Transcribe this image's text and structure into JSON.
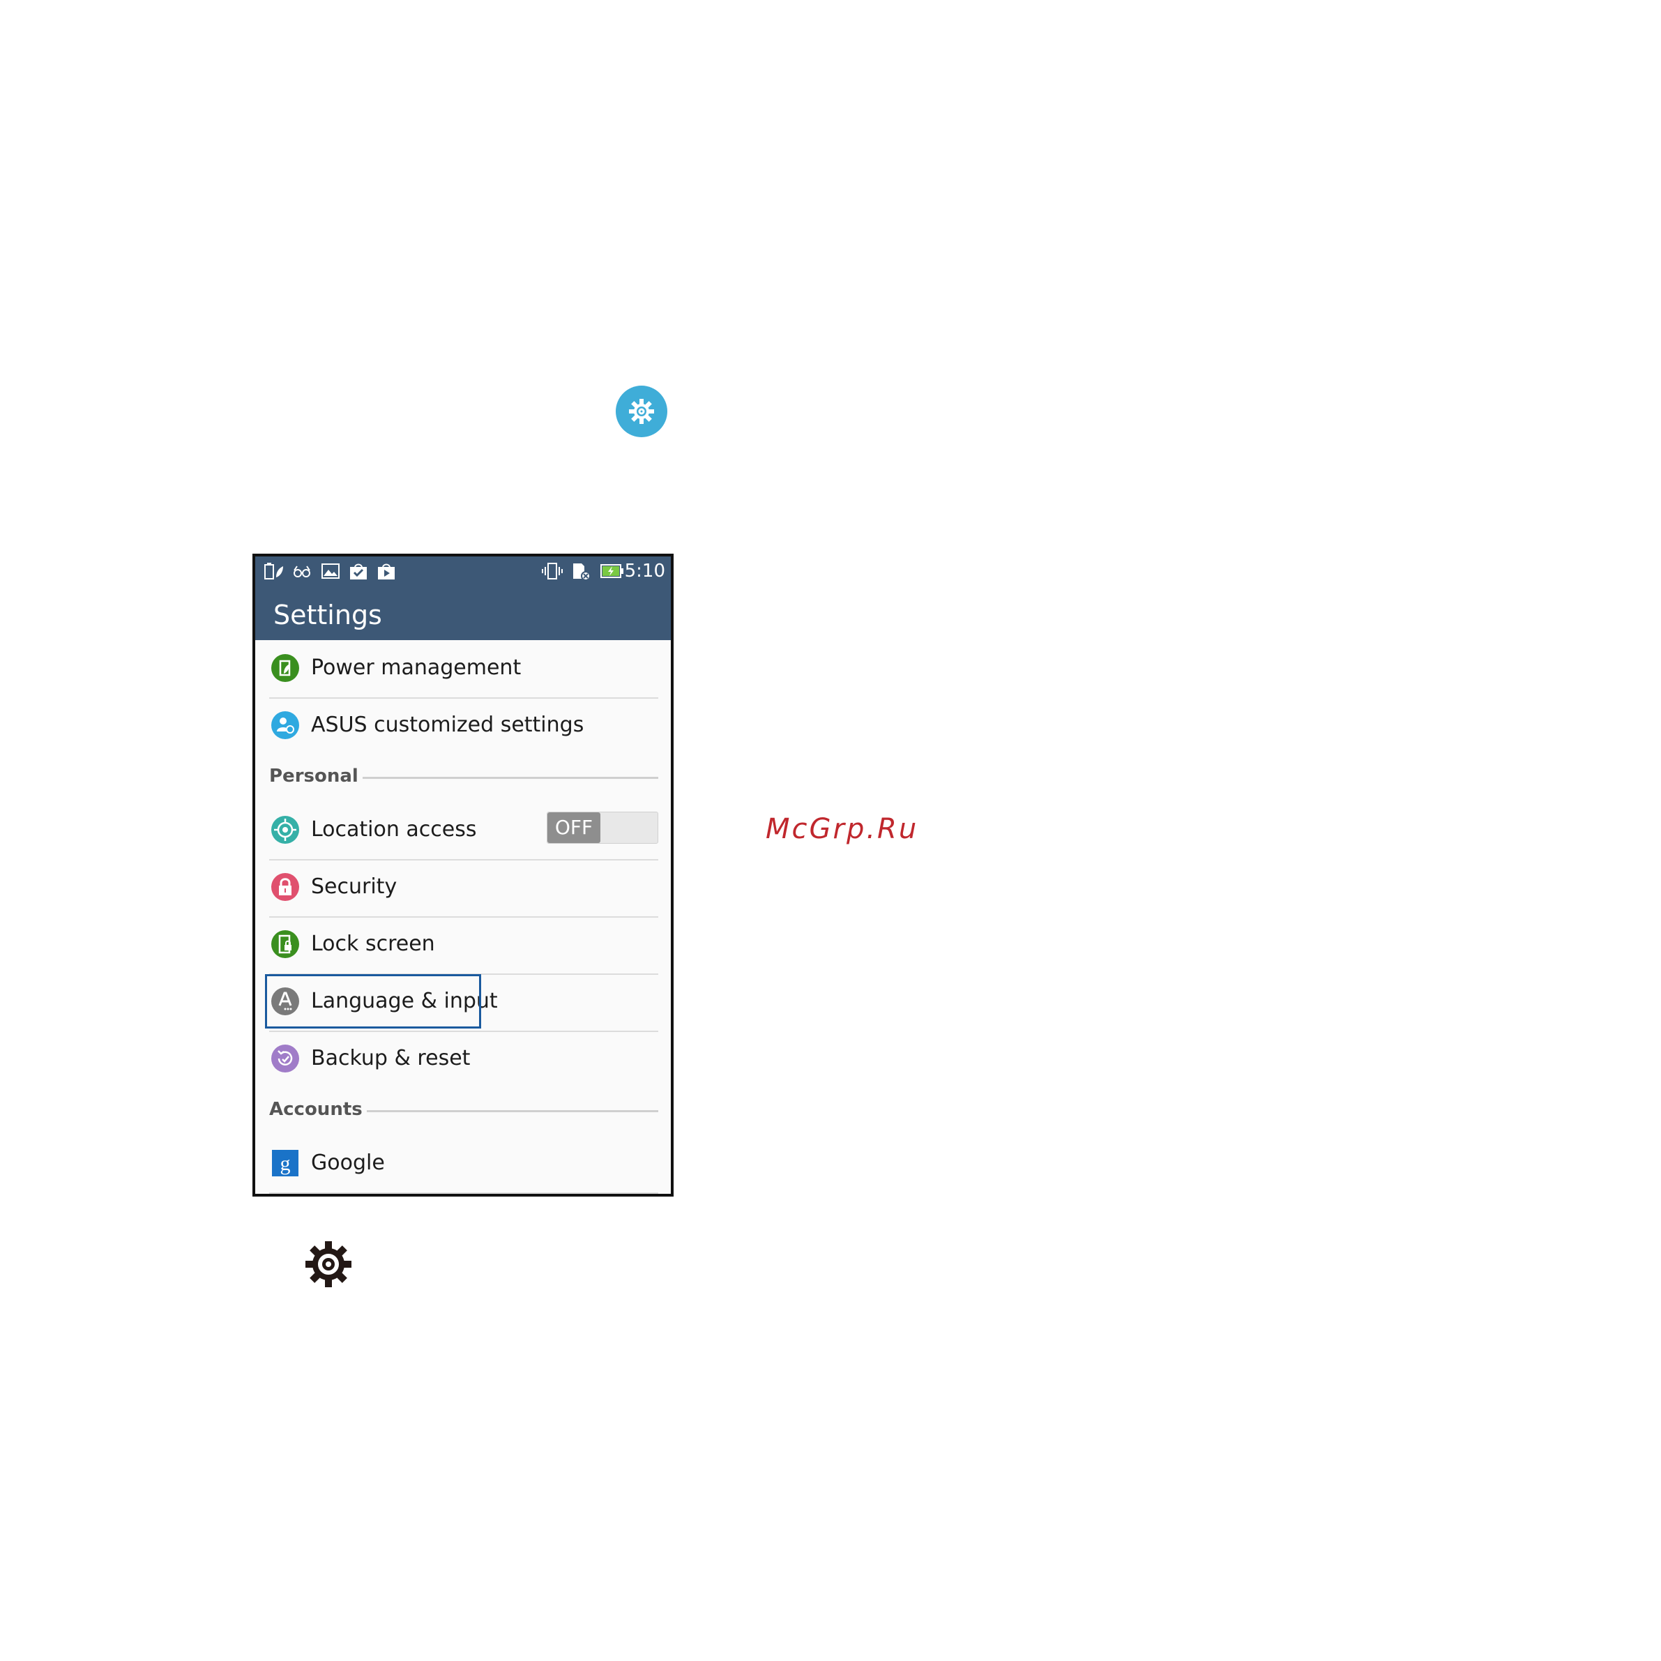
{
  "status_bar": {
    "time": "5:10",
    "left_icons": [
      "battery-leaf-icon",
      "glasses-icon",
      "image-icon",
      "shopping-bag-check-icon",
      "play-store-icon"
    ],
    "right_icons": [
      "vibrate-icon",
      "sd-card-icon",
      "battery-charging-icon"
    ]
  },
  "app_bar": {
    "title": "Settings"
  },
  "items": {
    "power": {
      "label": "Power management",
      "icon": "power-management-icon",
      "color": "#3a8f1f"
    },
    "asus": {
      "label": "ASUS customized settings",
      "icon": "asus-settings-icon",
      "color": "#2fa9e0"
    },
    "location": {
      "label": "Location access",
      "icon": "location-icon",
      "color": "#35b0a7"
    },
    "security": {
      "label": "Security",
      "icon": "lock-icon",
      "color": "#e0506e"
    },
    "lockscreen": {
      "label": "Lock screen",
      "icon": "lock-screen-icon",
      "color": "#3a8f1f"
    },
    "language": {
      "label": "Language & input",
      "icon": "language-icon",
      "color": "#7a7a7a"
    },
    "backup": {
      "label": "Backup & reset",
      "icon": "backup-icon",
      "color": "#a07cc8"
    },
    "google": {
      "label": "Google",
      "icon": "google-icon",
      "color": "#1a73c8"
    }
  },
  "sections": {
    "personal": "Personal",
    "accounts": "Accounts"
  },
  "toggle": {
    "state": "OFF"
  },
  "watermark": "McGrp.Ru",
  "colors": {
    "app_bar": "#3d5876",
    "top_gear": "#3fadd8",
    "highlight": "#1a5a9e"
  }
}
